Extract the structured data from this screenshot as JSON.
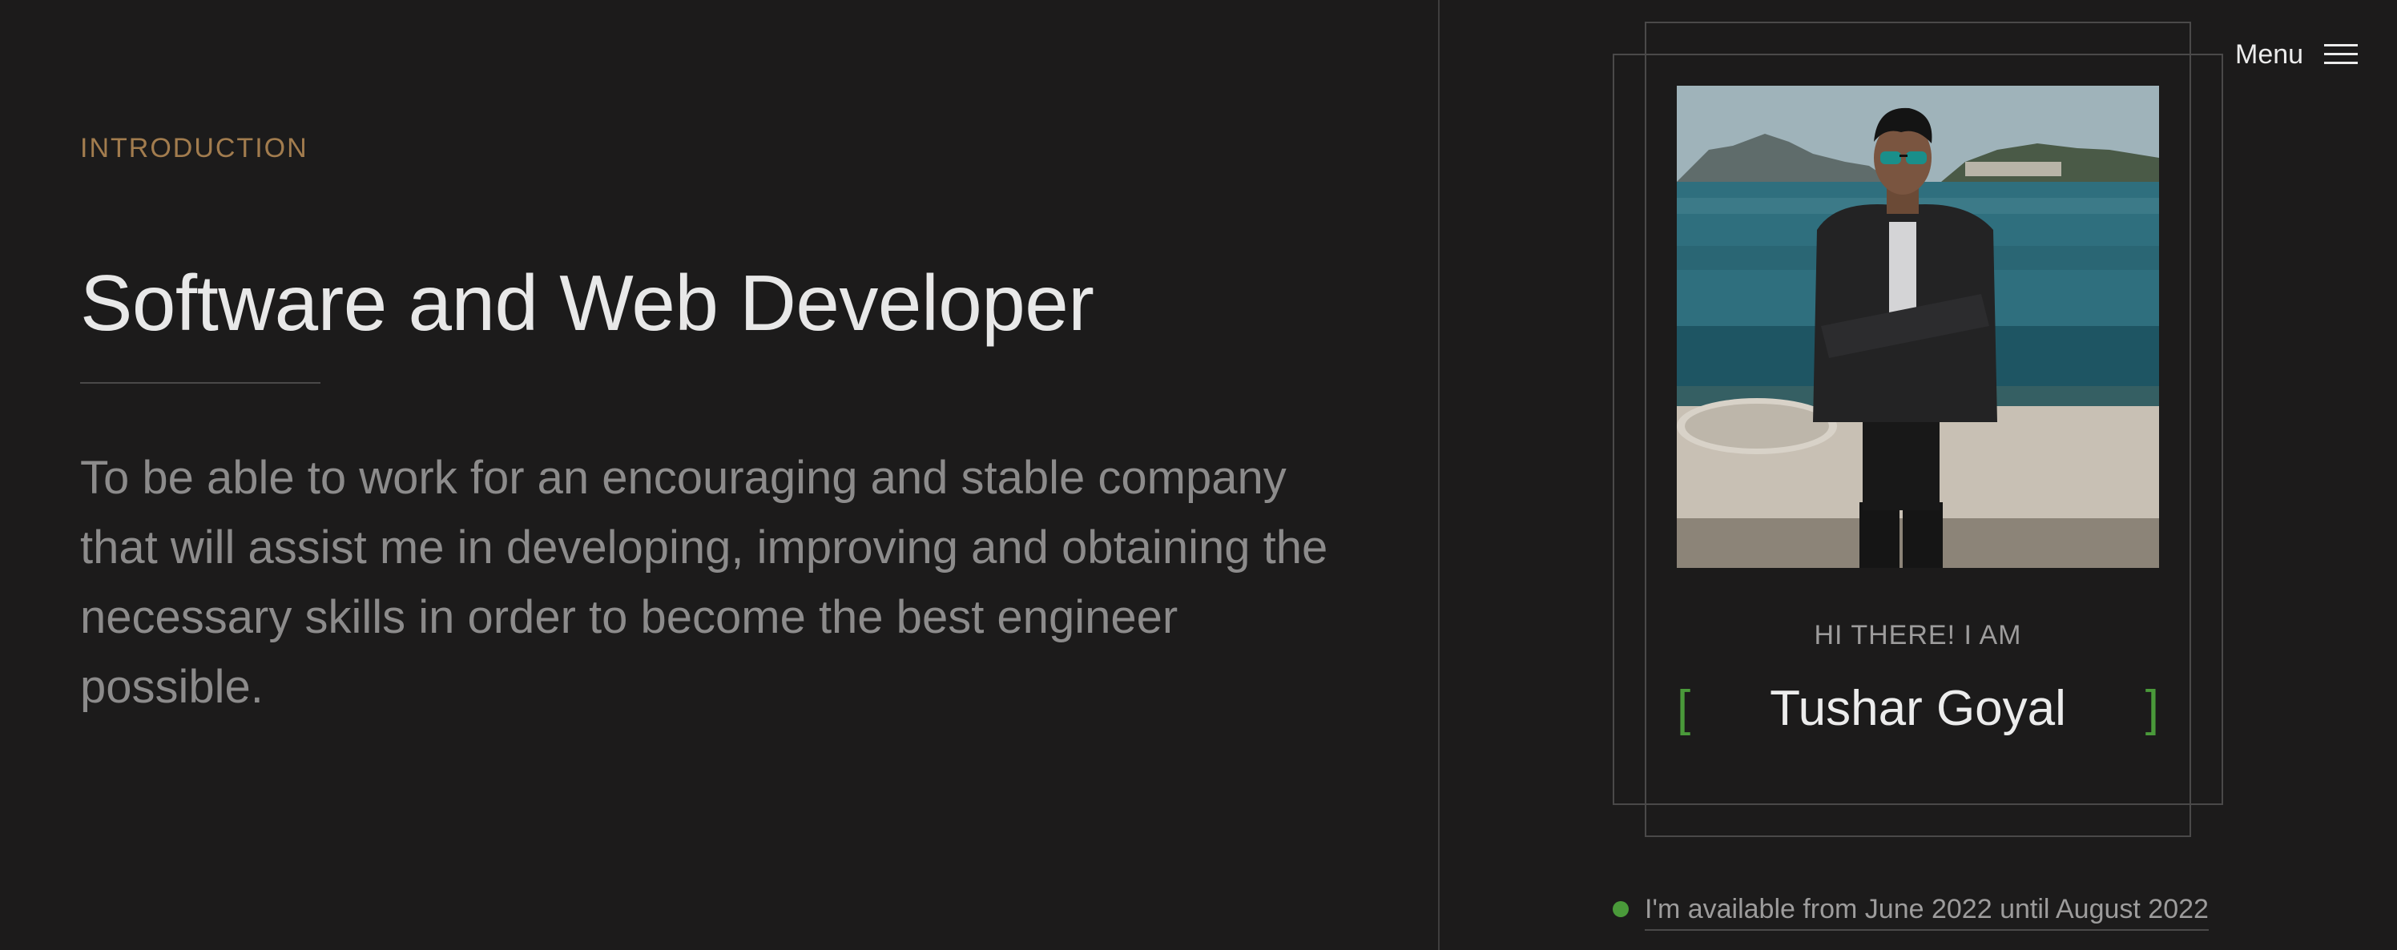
{
  "intro": {
    "label": "INTRODUCTION",
    "title": "Software and Web Developer",
    "text": "To be able to work for an encouraging and stable company that will assist me in developing, improving and obtaining the necessary skills in order to become the best engineer possible."
  },
  "menu": {
    "label": "Menu",
    "icon": "hamburger-icon"
  },
  "profile": {
    "greeting": "HI THERE! I AM",
    "name": "Tushar Goyal",
    "bracket_left": "[",
    "bracket_right": "]",
    "photo": "profile-photo"
  },
  "availability": {
    "text": "I'm available from June 2022 until August 2022",
    "status_color": "#4a9a3a"
  },
  "colors": {
    "background": "#1c1b1b",
    "accent_gold": "#a27c4e",
    "accent_green": "#4a9a3a",
    "text_primary": "#ececec",
    "text_muted": "#8c8b8b",
    "border": "#4a4949"
  }
}
